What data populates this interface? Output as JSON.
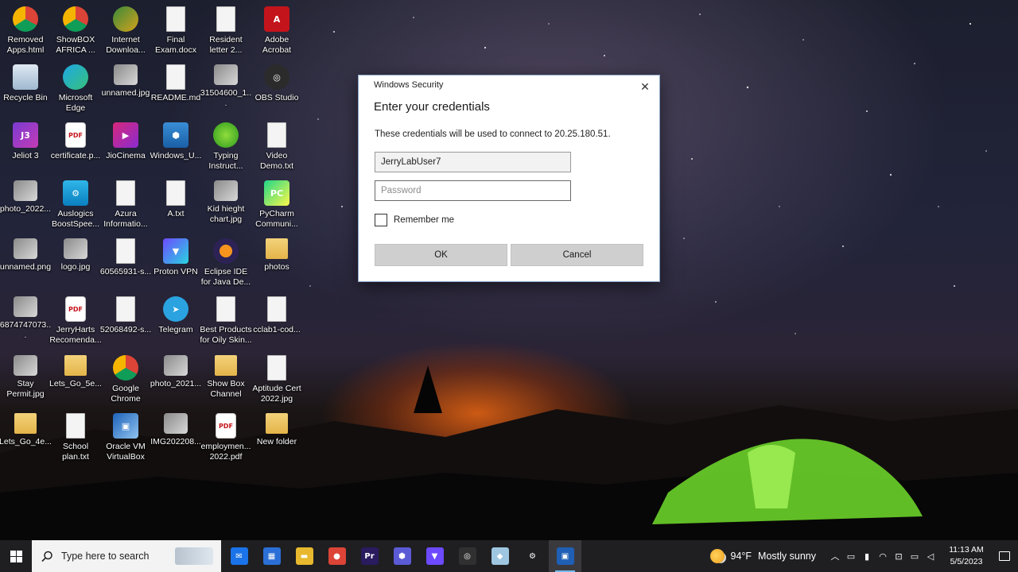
{
  "desktop": {
    "icons": [
      {
        "label": "Removed Apps.html",
        "kind": "chrome"
      },
      {
        "label": "ShowBOX AFRICA ...",
        "kind": "chrome"
      },
      {
        "label": "Internet Downloa...",
        "kind": "idm"
      },
      {
        "label": "Final Exam.docx",
        "kind": "doc"
      },
      {
        "label": "Resident letter 2...",
        "kind": "doc"
      },
      {
        "label": "Adobe Acrobat",
        "kind": "acrobat"
      },
      {
        "label": "Recycle Bin",
        "kind": "recycle"
      },
      {
        "label": "Microsoft Edge",
        "kind": "edge"
      },
      {
        "label": "unnamed.jpg",
        "kind": "photo"
      },
      {
        "label": "README.md",
        "kind": "doc"
      },
      {
        "label": "31504600_1...",
        "kind": "photo"
      },
      {
        "label": "OBS Studio",
        "kind": "obs"
      },
      {
        "label": "Jeliot 3",
        "kind": "jeliot"
      },
      {
        "label": "certificate.p...",
        "kind": "pdf"
      },
      {
        "label": "JioCinema",
        "kind": "jio"
      },
      {
        "label": "Windows_U...",
        "kind": "winupd"
      },
      {
        "label": "Typing Instruct...",
        "kind": "typing"
      },
      {
        "label": "Video Demo.txt",
        "kind": "doc"
      },
      {
        "label": "photo_2022...",
        "kind": "photo"
      },
      {
        "label": "Auslogics BoostSpee...",
        "kind": "auslogics"
      },
      {
        "label": "Azura Informatio...",
        "kind": "doc"
      },
      {
        "label": "A.txt",
        "kind": "doc"
      },
      {
        "label": "Kid hieght chart.jpg",
        "kind": "photo"
      },
      {
        "label": "PyCharm Communi...",
        "kind": "pycharm"
      },
      {
        "label": "unnamed.png",
        "kind": "photo"
      },
      {
        "label": "logo.jpg",
        "kind": "photo"
      },
      {
        "label": "60565931-s...",
        "kind": "doc"
      },
      {
        "label": "Proton VPN",
        "kind": "proton"
      },
      {
        "label": "Eclipse IDE for Java De...",
        "kind": "eclipse"
      },
      {
        "label": "photos",
        "kind": "folder"
      },
      {
        "label": "6874747073...",
        "kind": "photo"
      },
      {
        "label": "JerryHarts Recomenda...",
        "kind": "pdf"
      },
      {
        "label": "52068492-s...",
        "kind": "doc"
      },
      {
        "label": "Telegram",
        "kind": "telegram"
      },
      {
        "label": "Best Products for Oily Skin...",
        "kind": "doc"
      },
      {
        "label": "cclab1-cod...",
        "kind": "doc"
      },
      {
        "label": "Stay Permit.jpg",
        "kind": "photo"
      },
      {
        "label": "Lets_Go_5e...",
        "kind": "folder"
      },
      {
        "label": "Google Chrome",
        "kind": "chrome"
      },
      {
        "label": "photo_2021...",
        "kind": "photo"
      },
      {
        "label": "Show Box Channel",
        "kind": "folder"
      },
      {
        "label": "Aptitude Cert 2022.jpg",
        "kind": "doc"
      },
      {
        "label": "Lets_Go_4e...",
        "kind": "folder"
      },
      {
        "label": "School plan.txt",
        "kind": "doc"
      },
      {
        "label": "Oracle VM VirtualBox",
        "kind": "vbox"
      },
      {
        "label": "IMG202208...",
        "kind": "photo"
      },
      {
        "label": "employmen... 2022.pdf",
        "kind": "pdf"
      },
      {
        "label": "New folder",
        "kind": "folder"
      }
    ]
  },
  "dialog": {
    "caption": "Windows Security",
    "title": "Enter your credentials",
    "description": "These credentials will be used to connect to 20.25.180.51.",
    "username_value": "JerryLabUser7",
    "password_placeholder": "Password",
    "remember_label": "Remember me",
    "ok_label": "OK",
    "cancel_label": "Cancel",
    "close_glyph": "✕"
  },
  "taskbar": {
    "search_placeholder": "Type here to search",
    "apps": [
      {
        "name": "mail",
        "color": "#1a73e8",
        "glyph": "✉"
      },
      {
        "name": "store",
        "color": "#2b6fd6",
        "glyph": "▦"
      },
      {
        "name": "file-explorer",
        "color": "#e8b92e",
        "glyph": "▬"
      },
      {
        "name": "chrome",
        "color": "#db4437",
        "glyph": "●"
      },
      {
        "name": "premiere-pro",
        "color": "#2a1a5e",
        "glyph": "Pr"
      },
      {
        "name": "app-hex",
        "color": "#5b5bd6",
        "glyph": "⬢"
      },
      {
        "name": "proton-vpn",
        "color": "#6d4aff",
        "glyph": "▼"
      },
      {
        "name": "obs",
        "color": "#303030",
        "glyph": "◎"
      },
      {
        "name": "app-light",
        "color": "#9fc6e0",
        "glyph": "◆"
      },
      {
        "name": "settings",
        "color": "#1f1f22",
        "glyph": "⚙"
      },
      {
        "name": "remote-desktop",
        "color": "#1f5fb5",
        "glyph": "▣"
      }
    ],
    "weather": {
      "temp": "94°F",
      "condition": "Mostly sunny"
    },
    "time": "11:13 AM",
    "date": "5/5/2023"
  }
}
